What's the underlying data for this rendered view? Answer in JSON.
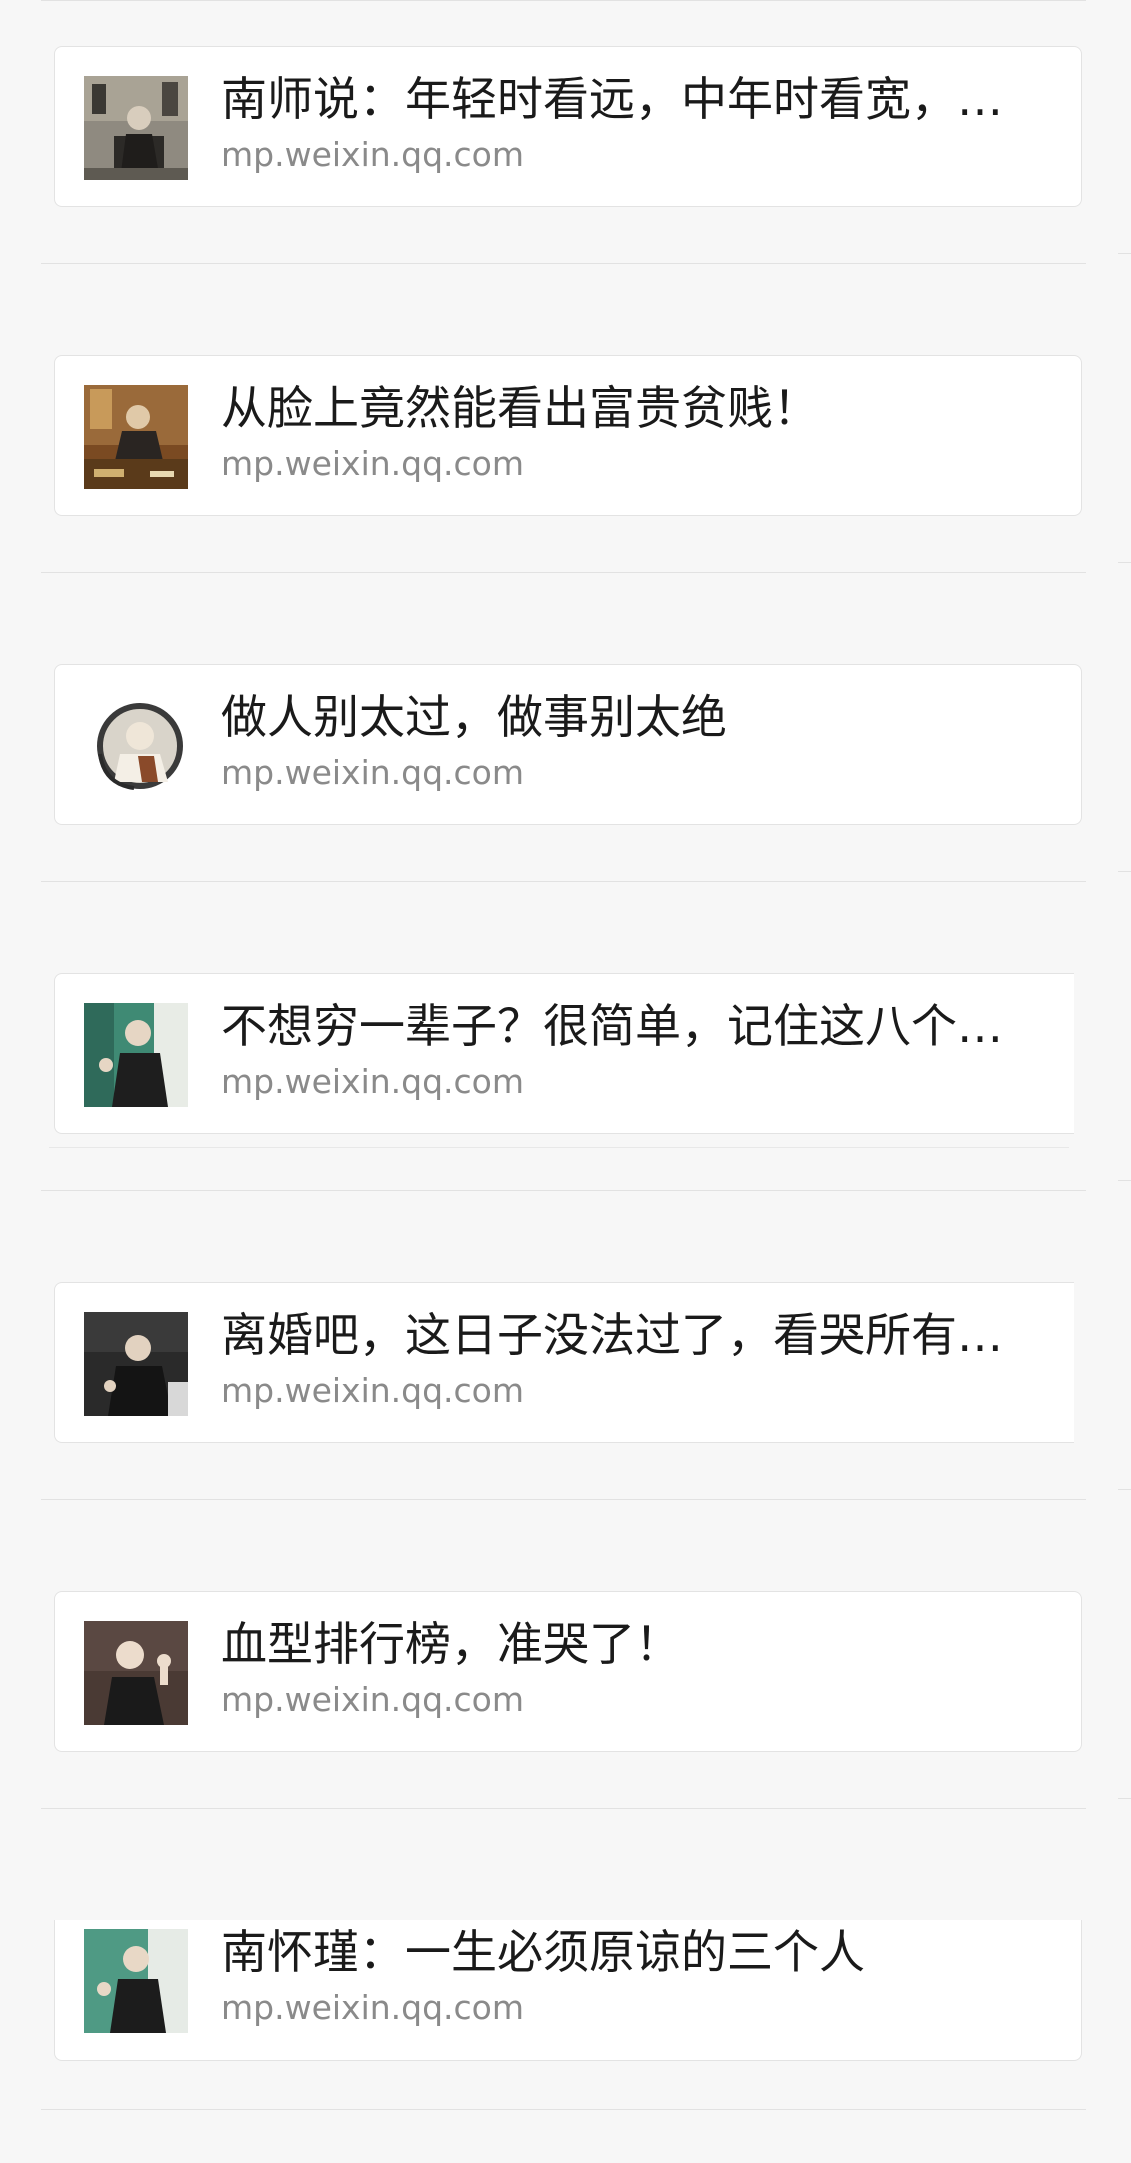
{
  "items": [
    {
      "title": "南师说：年轻时看远，中年时看宽，…",
      "domain": "mp.weixin.qq.com",
      "thumbnail_icon": "portrait-photo-seated-man"
    },
    {
      "title": "从脸上竟然能看出富贵贫贱！",
      "domain": "mp.weixin.qq.com",
      "thumbnail_icon": "portrait-photo-man-at-desk"
    },
    {
      "title": "做人别太过，做事别太绝",
      "domain": "mp.weixin.qq.com",
      "thumbnail_icon": "portrait-photo-round-vignette"
    },
    {
      "title": "不想穷一辈子？很简单，记住这八个…",
      "domain": "mp.weixin.qq.com",
      "thumbnail_icon": "portrait-photo-man-gesturing"
    },
    {
      "title": "离婚吧，这日子没法过了，看哭所有…",
      "domain": "mp.weixin.qq.com",
      "thumbnail_icon": "portrait-photo-man-dark-robe"
    },
    {
      "title": "血型排行榜，准哭了！",
      "domain": "mp.weixin.qq.com",
      "thumbnail_icon": "portrait-photo-man-speaking"
    },
    {
      "title": "南怀瑾：一生必须原谅的三个人",
      "domain": "mp.weixin.qq.com",
      "thumbnail_icon": "portrait-photo-man-lecturing"
    }
  ]
}
